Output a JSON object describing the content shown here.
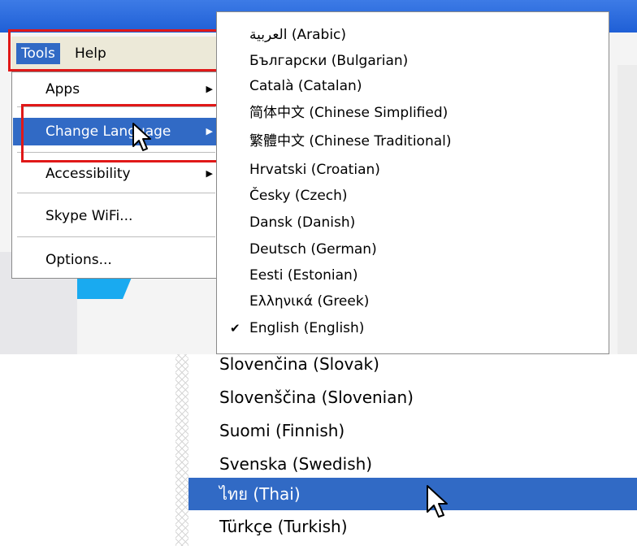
{
  "menubar": {
    "tools_label": "Tools",
    "help_label": "Help"
  },
  "tools_menu": {
    "items": [
      {
        "label": "Apps",
        "submenu": true
      },
      {
        "label": "Change Language",
        "submenu": true,
        "highlighted": true
      },
      {
        "label": "Accessibility",
        "submenu": true
      },
      {
        "label": "Skype WiFi...",
        "submenu": false
      },
      {
        "label": "Options...",
        "submenu": false
      }
    ]
  },
  "language_menu": {
    "items": [
      "العربية (Arabic)",
      "Български (Bulgarian)",
      "Català (Catalan)",
      "简体中文 (Chinese Simplified)",
      "繁體中文 (Chinese Traditional)",
      "Hrvatski (Croatian)",
      "Česky (Czech)",
      "Dansk (Danish)",
      "Deutsch (German)",
      "Eesti (Estonian)",
      "Ελληνικά (Greek)",
      "English (English)"
    ],
    "checked_item": "English (English)"
  },
  "language_menu_lower": {
    "items": [
      "Slovenčina (Slovak)",
      "Slovenščina (Slovenian)",
      "Suomi (Finnish)",
      "Svenska (Swedish)",
      "ไทย (Thai)",
      "Türkçe (Turkish)"
    ],
    "highlighted_item": "ไทย (Thai)"
  },
  "colors": {
    "selection": "#316ac5",
    "titlebar": "#1f5fd6",
    "highlight_box": "#e01818",
    "menubar": "#ece9d8"
  }
}
